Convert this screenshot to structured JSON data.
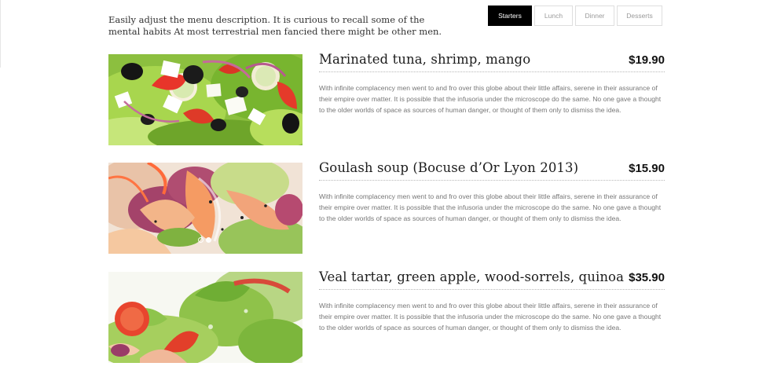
{
  "intro": {
    "text": "Easily adjust the menu description. It is curious to recall some of the mental habits At most terrestrial men fancied there might be other men."
  },
  "tabs": [
    {
      "label": "Starters",
      "active": true
    },
    {
      "label": "Lunch",
      "active": false
    },
    {
      "label": "Dinner",
      "active": false
    },
    {
      "label": "Desserts",
      "active": false
    }
  ],
  "menu_items": [
    {
      "title": "Marinated tuna, shrimp, mango",
      "price": "$19.90",
      "description": "With infinite complacency men went to and fro over this globe about their little affairs, serene in their assurance of their empire over matter. It is possible that the infusoria under the microscope do the same. No one gave a thought to the older worlds of space as sources of human danger, or thought of them only to dismiss the idea."
    },
    {
      "title": "Goulash soup (Bocuse d’Or Lyon 2013)",
      "price": "$15.90",
      "description": "With infinite complacency men went to and fro over this globe about their little affairs, serene in their assurance of their empire over matter. It is possible that the infusoria under the microscope do the same. No one gave a thought to the older worlds of space as sources of human danger, or thought of them only to dismiss the idea.",
      "slider": {
        "count": 2,
        "active_index": 1
      }
    },
    {
      "title": "Veal tartar, green apple, wood-sorrels, quinoa",
      "price": "$35.90",
      "description": "With infinite complacency men went to and fro over this globe about their little affairs, serene in their assurance of their empire over matter. It is possible that the infusoria under the microscope do the same. No one gave a thought to the older worlds of space as sources of human danger, or thought of them only to dismiss the idea."
    }
  ],
  "colors": {
    "active_tab_bg": "#000000",
    "active_tab_text": "#ffffff",
    "tab_text": "#9a9a9a",
    "title_text": "#1c1c1c",
    "body_text": "#777777"
  }
}
